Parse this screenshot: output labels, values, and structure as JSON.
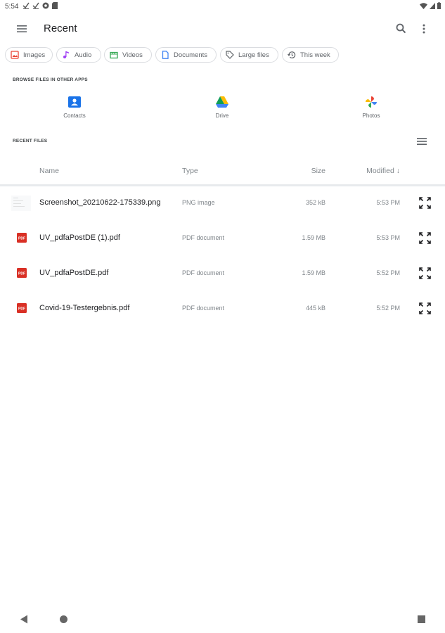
{
  "status_bar": {
    "time": "5:54",
    "left_icons": [
      "download-done-icon",
      "download-done-icon",
      "vpn-icon",
      "sd-card-icon"
    ],
    "right_icons": [
      "wifi-icon",
      "signal-icon",
      "battery-icon"
    ]
  },
  "app_bar": {
    "title": "Recent",
    "icons": [
      "hamburger-menu-icon",
      "search-icon",
      "more-vert-icon"
    ]
  },
  "chips": [
    {
      "label": "Images",
      "icon": "image-icon",
      "color": "#ea4335"
    },
    {
      "label": "Audio",
      "icon": "music-note-icon",
      "color": "#a142f4"
    },
    {
      "label": "Videos",
      "icon": "movie-icon",
      "color": "#34a853"
    },
    {
      "label": "Documents",
      "icon": "document-icon",
      "color": "#4285f4"
    },
    {
      "label": "Large files",
      "icon": "tag-icon",
      "color": "#5f6368"
    },
    {
      "label": "This week",
      "icon": "history-icon",
      "color": "#5f6368"
    }
  ],
  "browse_section": {
    "label": "BROWSE FILES IN OTHER APPS",
    "apps": [
      {
        "label": "Contacts",
        "icon": "contacts-icon"
      },
      {
        "label": "Drive",
        "icon": "drive-icon"
      },
      {
        "label": "Photos",
        "icon": "photos-icon"
      }
    ]
  },
  "recent_section": {
    "label": "RECENT FILES",
    "view_toggle_icon": "list-view-icon"
  },
  "table": {
    "columns": [
      "Name",
      "Type",
      "Size",
      "Modified"
    ],
    "sort_indicator": "↓",
    "rows": [
      {
        "name": "Screenshot_20210622-175339.png",
        "type": "PNG image",
        "size": "352 kB",
        "modified": "5:53 PM",
        "icon": "image-thumbnail"
      },
      {
        "name": "UV_pdfaPostDE (1).pdf",
        "type": "PDF document",
        "size": "1.59 MB",
        "modified": "5:53 PM",
        "icon": "pdf-icon"
      },
      {
        "name": "UV_pdfaPostDE.pdf",
        "type": "PDF document",
        "size": "1.59 MB",
        "modified": "5:52 PM",
        "icon": "pdf-icon"
      },
      {
        "name": "Covid-19-Testergebnis.pdf",
        "type": "PDF document",
        "size": "445 kB",
        "modified": "5:52 PM",
        "icon": "pdf-icon"
      }
    ]
  },
  "nav_bar": {
    "icons": [
      "back-icon",
      "home-icon",
      "recents-icon"
    ]
  },
  "colors": {
    "accent": "#1a73e8",
    "pdf_red": "#d93025",
    "text_primary": "#202124",
    "text_secondary": "#80868b"
  }
}
